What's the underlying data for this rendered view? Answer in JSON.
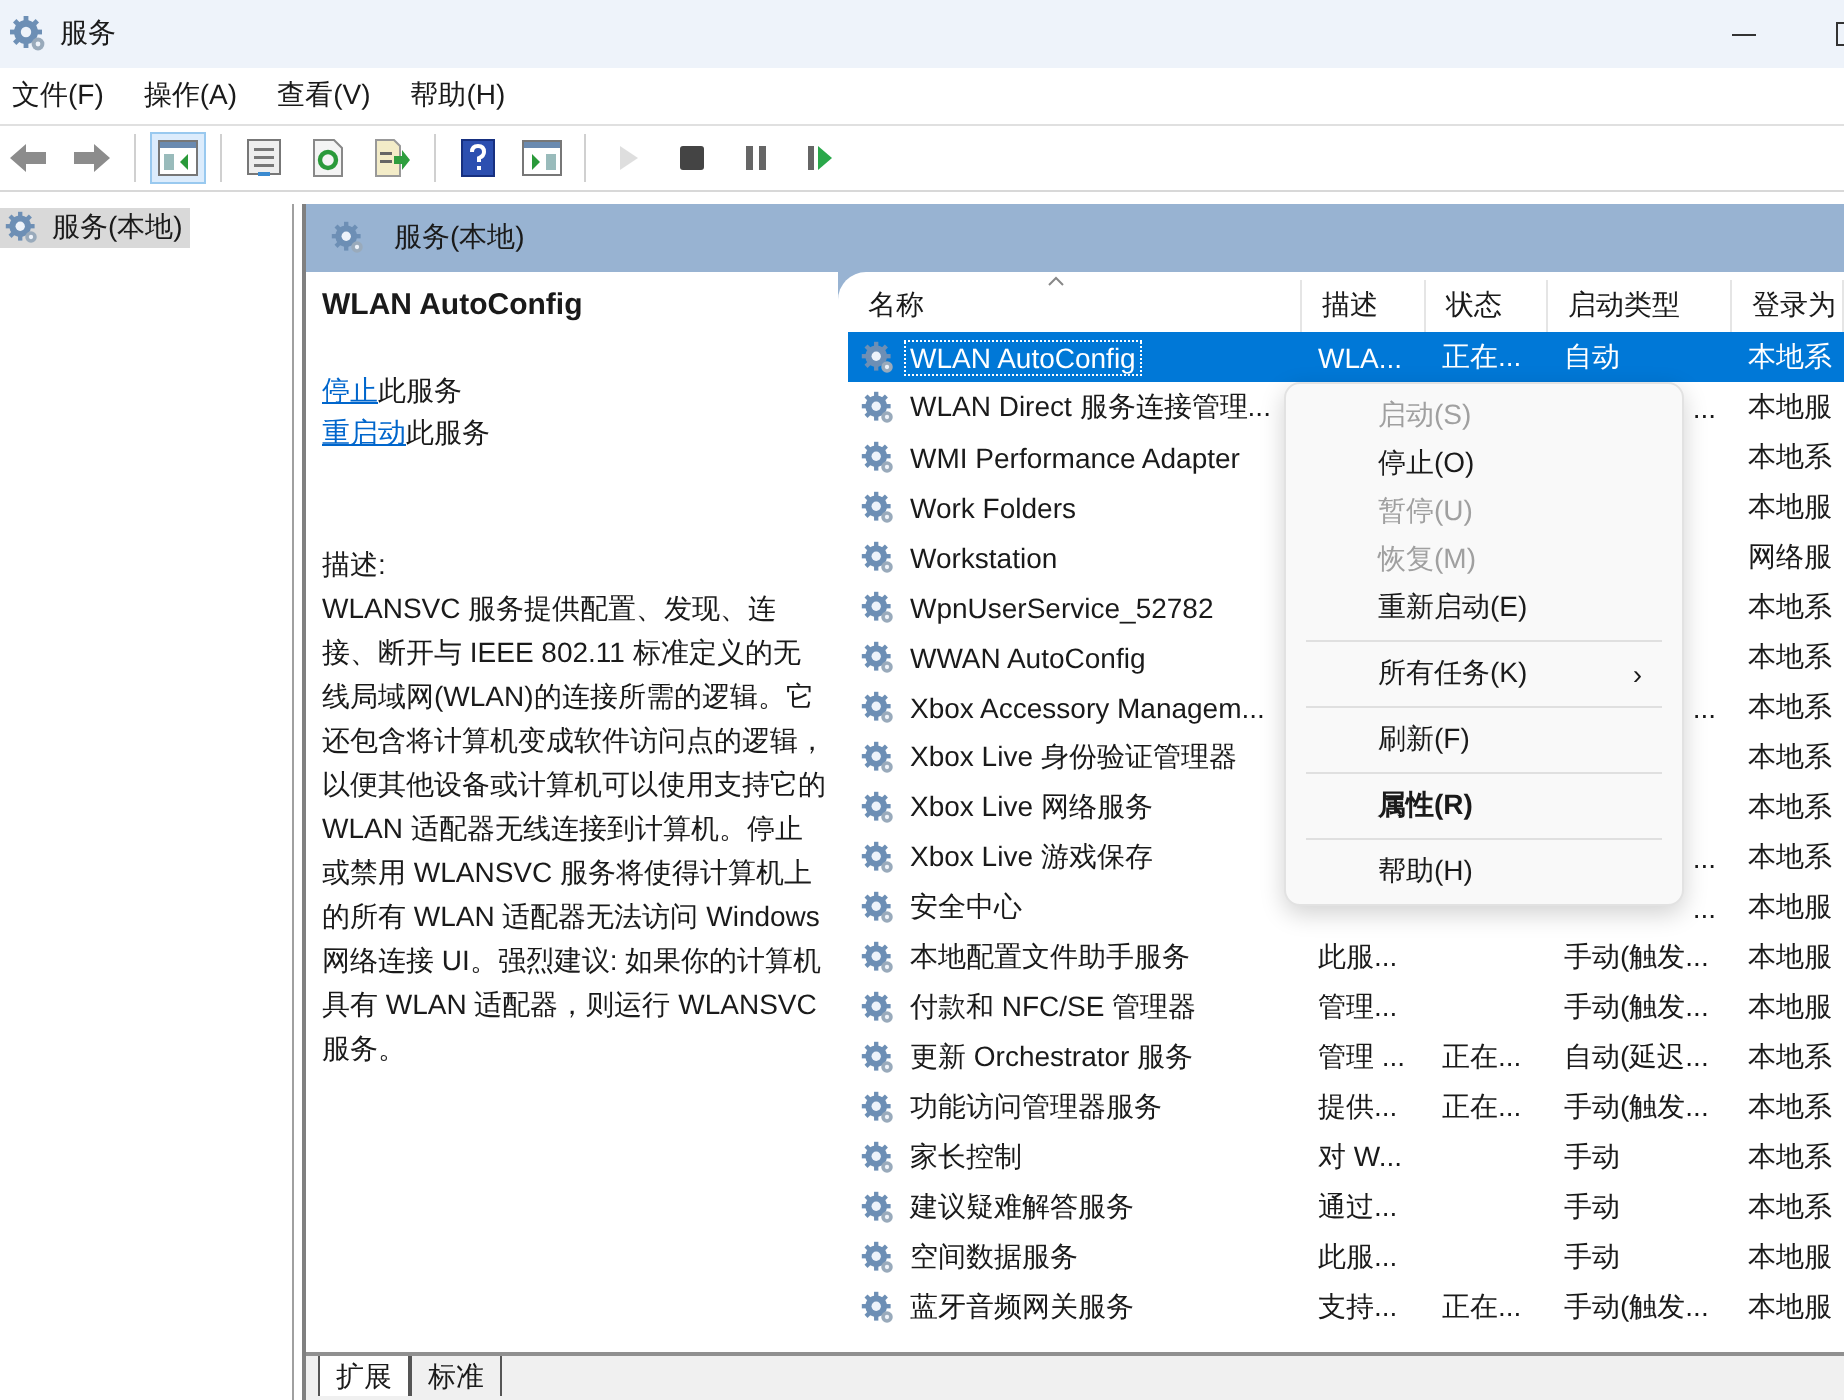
{
  "window": {
    "title": "服务"
  },
  "menu": [
    "文件(F)",
    "操作(A)",
    "查看(V)",
    "帮助(H)"
  ],
  "toolbar": [
    {
      "kind": "back",
      "pressed": false,
      "disabled": false
    },
    {
      "kind": "forward",
      "pressed": false,
      "disabled": false
    },
    {
      "kind": "sep"
    },
    {
      "kind": "tree",
      "pressed": true,
      "disabled": false
    },
    {
      "kind": "sep"
    },
    {
      "kind": "properties",
      "pressed": false,
      "disabled": false
    },
    {
      "kind": "refresh",
      "pressed": false,
      "disabled": false
    },
    {
      "kind": "export",
      "pressed": false,
      "disabled": false
    },
    {
      "kind": "sep"
    },
    {
      "kind": "help",
      "pressed": false,
      "disabled": false
    },
    {
      "kind": "pane",
      "pressed": false,
      "disabled": false
    },
    {
      "kind": "sep"
    },
    {
      "kind": "play",
      "pressed": false,
      "disabled": true
    },
    {
      "kind": "stop",
      "pressed": false,
      "disabled": false
    },
    {
      "kind": "pause",
      "pressed": false,
      "disabled": false
    },
    {
      "kind": "restart",
      "pressed": false,
      "disabled": false
    }
  ],
  "tree": {
    "items": [
      {
        "label": "服务(本地)",
        "selected": true
      }
    ]
  },
  "panel": {
    "title": "服务(本地)"
  },
  "details": {
    "service_name": "WLAN AutoConfig",
    "actions": [
      {
        "link": "停止",
        "text": "此服务"
      },
      {
        "link": "重启动",
        "text": "此服务"
      }
    ],
    "description_label": "描述:",
    "description": "WLANSVC 服务提供配置、发现、连接、断开与 IEEE 802.11 标准定义的无线局域网(WLAN)的连接所需的逻辑。它还包含将计算机变成软件访问点的逻辑，以便其他设备或计算机可以使用支持它的 WLAN 适配器无线连接到计算机。停止或禁用 WLANSVC 服务将使得计算机上的所有 WLAN 适配器无法访问 Windows 网络连接 UI。强烈建议: 如果你的计算机具有 WLAN 适配器，则运行 WLANSVC 服务。"
  },
  "table": {
    "columns": [
      "名称",
      "描述",
      "状态",
      "启动类型",
      "登录为"
    ],
    "rows": [
      {
        "name": "WLAN AutoConfig",
        "description": "WLA...",
        "status": "正在...",
        "startup": "自动",
        "logon": "本地系",
        "selected": true
      },
      {
        "name": "WLAN Direct 服务连接管理...",
        "startup_tail": "...",
        "logon": "本地服",
        "selected": false
      },
      {
        "name": "WMI Performance Adapter",
        "logon": "本地系",
        "selected": false
      },
      {
        "name": "Work Folders",
        "logon": "本地服",
        "selected": false
      },
      {
        "name": "Workstation",
        "logon": "网络服",
        "selected": false
      },
      {
        "name": "WpnUserService_52782",
        "logon": "本地系",
        "selected": false
      },
      {
        "name": "WWAN AutoConfig",
        "logon": "本地系",
        "selected": false
      },
      {
        "name": "Xbox Accessory Managem...",
        "startup_tail": "...",
        "logon": "本地系",
        "selected": false
      },
      {
        "name": "Xbox Live 身份验证管理器",
        "logon": "本地系",
        "selected": false
      },
      {
        "name": "Xbox Live 网络服务",
        "logon": "本地系",
        "selected": false
      },
      {
        "name": "Xbox Live 游戏保存",
        "startup_tail": "...",
        "logon": "本地系",
        "selected": false
      },
      {
        "name": "安全中心",
        "startup_tail": "...",
        "logon": "本地服",
        "selected": false
      },
      {
        "name": "本地配置文件助手服务",
        "description": "此服...",
        "startup": "手动(触发...",
        "logon": "本地服",
        "selected": false
      },
      {
        "name": "付款和 NFC/SE 管理器",
        "description": "管理...",
        "startup": "手动(触发...",
        "logon": "本地服",
        "selected": false
      },
      {
        "name": "更新 Orchestrator 服务",
        "description": "管理 ...",
        "status": "正在...",
        "startup": "自动(延迟...",
        "logon": "本地系",
        "selected": false
      },
      {
        "name": "功能访问管理器服务",
        "description": "提供...",
        "status": "正在...",
        "startup": "手动(触发...",
        "logon": "本地系",
        "selected": false
      },
      {
        "name": "家长控制",
        "description": "对 W...",
        "startup": "手动",
        "logon": "本地系",
        "selected": false
      },
      {
        "name": "建议疑难解答服务",
        "description": "通过...",
        "startup": "手动",
        "logon": "本地系",
        "selected": false
      },
      {
        "name": "空间数据服务",
        "description": "此服...",
        "startup": "手动",
        "logon": "本地服",
        "selected": false
      },
      {
        "name": "蓝牙音频网关服务",
        "description": "支持...",
        "status": "正在...",
        "startup": "手动(触发...",
        "logon": "本地服",
        "selected": false
      }
    ]
  },
  "context_menu": [
    {
      "kind": "item",
      "label": "启动(S)",
      "disabled": true,
      "bold": false
    },
    {
      "kind": "item",
      "label": "停止(O)",
      "disabled": false,
      "bold": false
    },
    {
      "kind": "item",
      "label": "暂停(U)",
      "disabled": true,
      "bold": false
    },
    {
      "kind": "item",
      "label": "恢复(M)",
      "disabled": true,
      "bold": false
    },
    {
      "kind": "item",
      "label": "重新启动(E)",
      "disabled": false,
      "bold": false
    },
    {
      "kind": "separator"
    },
    {
      "kind": "submenu",
      "label": "所有任务(K)",
      "arrow": "›",
      "disabled": false,
      "bold": false
    },
    {
      "kind": "separator"
    },
    {
      "kind": "item",
      "label": "刷新(F)",
      "disabled": false,
      "bold": false
    },
    {
      "kind": "separator"
    },
    {
      "kind": "item",
      "label": "属性(R)",
      "disabled": false,
      "bold": true
    },
    {
      "kind": "separator"
    },
    {
      "kind": "item",
      "label": "帮助(H)",
      "disabled": false,
      "bold": false
    }
  ],
  "view_tabs": [
    {
      "label": "扩展",
      "selected": true
    },
    {
      "label": "标准",
      "selected": false
    }
  ]
}
